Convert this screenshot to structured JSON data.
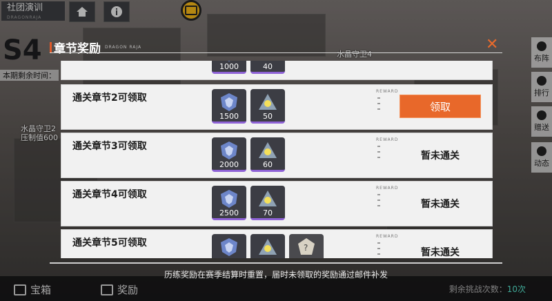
{
  "background": {
    "club_title": "社团演训",
    "club_subtitle": "DRAGONRAJA",
    "season": "S4",
    "period_label": "本期剩余时间：",
    "crystal_left": [
      "水晶守卫2",
      "压制值600"
    ],
    "crystal_right": [
      "水晶守卫4"
    ],
    "right_nav": [
      "布阵",
      "排行",
      "赠送",
      "动态"
    ],
    "bottom_tabs": [
      "宝箱",
      "奖励"
    ],
    "challenge_label": "剩余挑战次数：",
    "challenge_count": "10次"
  },
  "panel": {
    "title": "章节奖励",
    "title_sub": "DRAGON RAJA",
    "close_icon": "close-x-icon",
    "accent_color": "#e8682a",
    "reward_tag": "REWARD",
    "rows": [
      {
        "title": "",
        "items": [
          {
            "icon": "gem-shield-icon",
            "amount": "1000"
          },
          {
            "icon": "spark-triangle-icon",
            "amount": "40"
          }
        ],
        "status": ""
      },
      {
        "title": "通关章节2可领取",
        "items": [
          {
            "icon": "gem-shield-icon",
            "amount": "1500"
          },
          {
            "icon": "spark-triangle-icon",
            "amount": "50"
          }
        ],
        "status": "claim",
        "claim_label": "领取"
      },
      {
        "title": "通关章节3可领取",
        "items": [
          {
            "icon": "gem-shield-icon",
            "amount": "2000"
          },
          {
            "icon": "spark-triangle-icon",
            "amount": "60"
          }
        ],
        "status": "pending",
        "pending_label": "暂未通关"
      },
      {
        "title": "通关章节4可领取",
        "items": [
          {
            "icon": "gem-shield-icon",
            "amount": "2500"
          },
          {
            "icon": "spark-triangle-icon",
            "amount": "70"
          }
        ],
        "status": "pending",
        "pending_label": "暂未通关"
      },
      {
        "title": "通关章节5可领取",
        "items": [
          {
            "icon": "gem-shield-icon",
            "amount": ""
          },
          {
            "icon": "spark-triangle-icon",
            "amount": ""
          },
          {
            "icon": "mystery-crystal-icon",
            "amount": ""
          }
        ],
        "status": "pending",
        "pending_label": "暂未通关"
      }
    ],
    "footnote": "历练奖励在赛季结算时重置，届时未领取的奖励通过邮件补发"
  }
}
